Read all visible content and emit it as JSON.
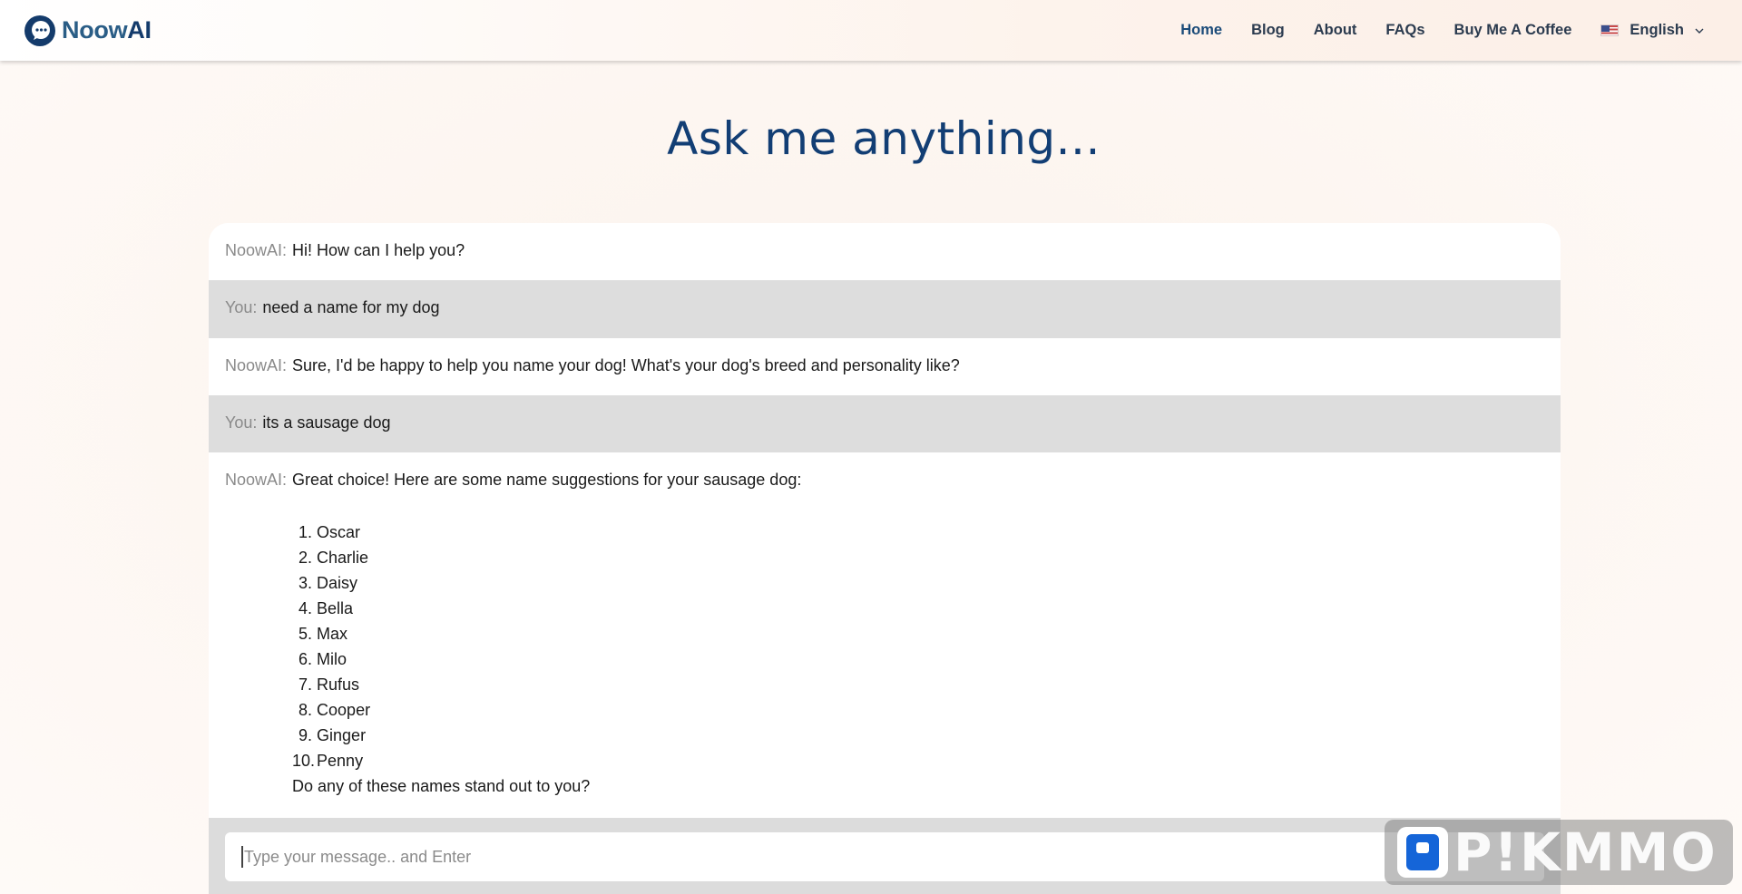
{
  "brand": {
    "name_part1": "Noow",
    "name_part2": "AI"
  },
  "nav": {
    "items": [
      {
        "label": "Home",
        "active": true
      },
      {
        "label": "Blog"
      },
      {
        "label": "About"
      },
      {
        "label": "FAQs"
      },
      {
        "label": "Buy Me A Coffee"
      }
    ],
    "language": "English"
  },
  "title": "Ask me anything...",
  "chat": {
    "messages": [
      {
        "sender": "NoowAI:",
        "text": "Hi! How can I help you?"
      },
      {
        "sender": "You:",
        "text": "need a name for my dog"
      },
      {
        "sender": "NoowAI:",
        "text": "Sure, I'd be happy to help you name your dog! What's your dog's breed and personality like?"
      },
      {
        "sender": "You:",
        "text": "its a sausage dog"
      },
      {
        "sender": "NoowAI:",
        "text": "Great choice! Here are some name suggestions for your sausage dog:",
        "list": [
          "Oscar",
          "Charlie",
          "Daisy",
          "Bella",
          "Max",
          "Milo",
          "Rufus",
          "Cooper",
          "Ginger",
          "Penny"
        ],
        "closing": "Do any of these names stand out to you?"
      }
    ]
  },
  "input": {
    "placeholder": "Type your message.. and Enter"
  },
  "watermark": "P!KMMO",
  "colors": {
    "title": "#123e74",
    "user_row": "#dddddd",
    "brand_dark": "#143b6b",
    "brand_light": "#2a5d86"
  }
}
